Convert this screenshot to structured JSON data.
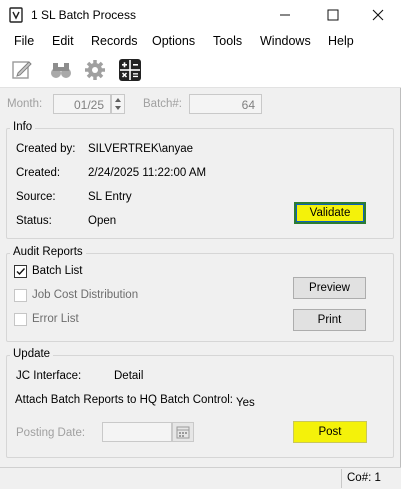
{
  "window": {
    "title": "1 SL Batch Process"
  },
  "menu": [
    "File",
    "Edit",
    "Records",
    "Options",
    "Tools",
    "Windows",
    "Help"
  ],
  "toolbar": {
    "icons": [
      "edit-icon",
      "binoculars-icon",
      "gear-icon",
      "calculator-icon"
    ]
  },
  "header": {
    "month_label": "Month:",
    "month_value": "01/25",
    "batch_label": "Batch#:",
    "batch_value": "64"
  },
  "info": {
    "title": "Info",
    "created_by_label": "Created by:",
    "created_by_value": "SILVERTREK\\anyae",
    "created_label": "Created:",
    "created_value": "2/24/2025 11:22:00 AM",
    "source_label": "Source:",
    "source_value": "SL Entry",
    "status_label": "Status:",
    "status_value": "Open",
    "validate_label": "Validate"
  },
  "audit": {
    "title": "Audit Reports",
    "batch_list_label": "Batch List",
    "batch_list_checked": true,
    "job_cost_label": "Job Cost Distribution",
    "job_cost_checked": false,
    "error_list_label": "Error List",
    "error_list_checked": false,
    "preview_label": "Preview",
    "print_label": "Print"
  },
  "update": {
    "title": "Update",
    "jc_label": "JC Interface:",
    "jc_value": "Detail",
    "attach_label": "Attach Batch Reports to HQ Batch Control:",
    "attach_value": "Yes",
    "posting_label": "Posting Date:",
    "posting_value": "",
    "post_label": "Post"
  },
  "status": {
    "co_label": "Co#: 1"
  },
  "colors": {
    "highlight": "#f4f20a",
    "focus": "#2e7d32"
  }
}
